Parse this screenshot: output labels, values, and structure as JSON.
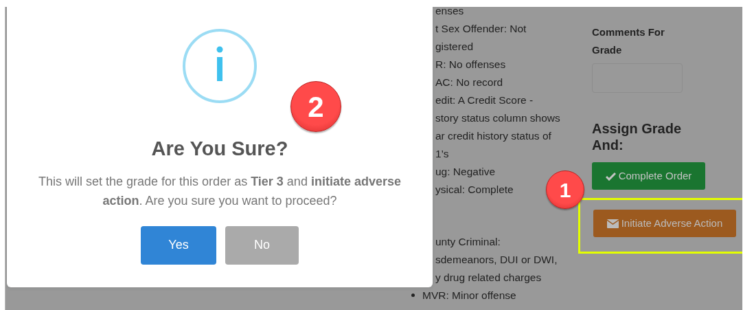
{
  "dialog": {
    "title": "Are You Sure?",
    "message": "This will set the grade for this order as **Tier 3** and **initiate adverse action**. Are you sure you want to proceed?",
    "buttons": [
      {
        "label": "Yes",
        "kind": "confirm"
      },
      {
        "label": "No",
        "kind": "cancel"
      }
    ]
  },
  "results_list": {
    "upper": [
      {
        "text": "enses",
        "kind": "cut"
      },
      {
        "text": "t Sex Offender: Not",
        "kind": "cut"
      },
      {
        "text": "gistered",
        "kind": "cut"
      },
      {
        "text": "R: No offenses",
        "kind": "cut"
      },
      {
        "text": "AC: No record",
        "kind": "cut"
      },
      {
        "text": "edit: A Credit Score -",
        "kind": "cut"
      },
      {
        "text": "story status column shows",
        "kind": "cut"
      },
      {
        "text": "ar credit history status of",
        "kind": "cut"
      },
      {
        "text": "1’s",
        "kind": "cut"
      },
      {
        "text": "ug: Negative",
        "kind": "cut"
      },
      {
        "text": "ysical: Complete",
        "kind": "cut"
      }
    ],
    "lower": [
      {
        "text": "unty Criminal:",
        "kind": "cut"
      },
      {
        "text": "sdemeanors, DUI or DWI,",
        "kind": "cut"
      },
      {
        "text": "y drug related charges",
        "kind": "cut"
      },
      {
        "text": "MVR: Minor offense",
        "kind": "bullet"
      }
    ]
  },
  "grade_panel": {
    "comments_label": "Comments For Grade",
    "assign_heading": "Assign Grade And:",
    "actions": [
      {
        "label": "Complete Order",
        "kind": "complete",
        "highlighted": false
      },
      {
        "label": "Initiate Adverse Action",
        "kind": "adverse",
        "highlighted": true
      }
    ]
  },
  "callouts": [
    {
      "number": "1"
    },
    {
      "number": "2"
    }
  ]
}
